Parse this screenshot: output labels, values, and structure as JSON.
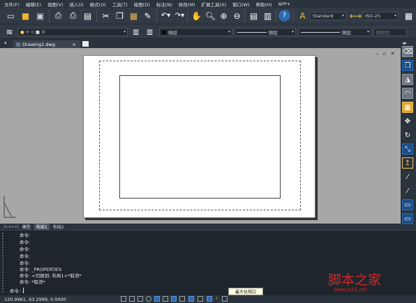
{
  "menu": [
    "文件(F)",
    "编辑(E)",
    "视图(V)",
    "插入(I)",
    "格式(O)",
    "工具(T)",
    "绘图(D)",
    "标注(N)",
    "修改(M)",
    "扩展工具(X)",
    "窗口(W)",
    "帮助(H)",
    "APP+"
  ],
  "toolbar": {
    "text_style": "Standard",
    "dim_style": "ISO-25",
    "layer": "0",
    "color": "随层",
    "linetype": "随层",
    "lineweight": "随层",
    "plotstyle": "随颜色"
  },
  "tab": {
    "label": "Drawing1.dwg",
    "close": "×"
  },
  "layout_tabs": [
    "模型",
    "布局1",
    "布局2"
  ],
  "command_lines": [
    "命令:",
    "命令:",
    "命令:",
    "命令:",
    "命令:",
    "命令: _PROPERTIES",
    "命令: <切换到: 布局1>*取消*",
    "命令: *取消*"
  ],
  "command_prompt": "命令:",
  "tooltip": "最大化视口",
  "status": {
    "coords": "120.9961, 63.2999, 0.0000"
  },
  "watermark": {
    "text": "脚本之家",
    "url": "www.jb51.net"
  },
  "colors": {
    "accent": "#2c6ab0",
    "background": "#2b333d",
    "canvas": "#a7a7a7"
  }
}
